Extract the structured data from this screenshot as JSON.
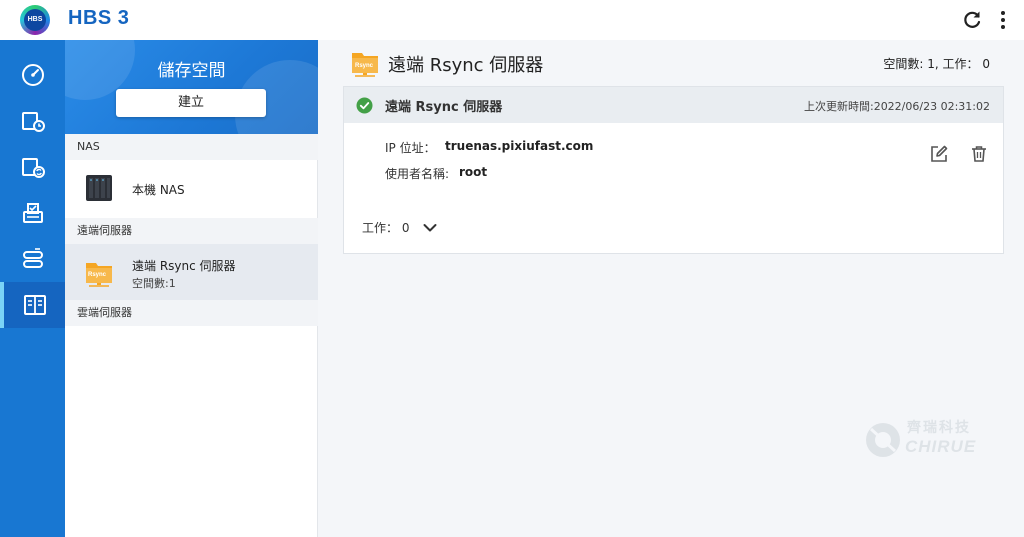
{
  "app": {
    "title": "HBS 3",
    "logo_text": "HBS"
  },
  "topbar": {
    "refresh_icon": "refresh-icon",
    "more_icon": "more-vertical-icon"
  },
  "rail": {
    "items": [
      {
        "icon": "speedometer-icon",
        "active": false
      },
      {
        "icon": "backup-icon",
        "active": false
      },
      {
        "icon": "sync-icon",
        "active": false
      },
      {
        "icon": "restore-icon",
        "active": false
      },
      {
        "icon": "services-icon",
        "active": false
      },
      {
        "icon": "storage-spaces-icon",
        "active": true
      }
    ]
  },
  "storage_panel": {
    "title": "儲存空間",
    "create_label": "建立",
    "sections": {
      "nas": "NAS",
      "remote": "遠端伺服器",
      "cloud": "雲端伺服器"
    },
    "local_nas": {
      "name": "本機 NAS"
    },
    "rsync": {
      "name": "遠端 Rsync 伺服器",
      "sub": "空間數:1",
      "badge": "Rsync"
    }
  },
  "main": {
    "title": "遠端 Rsync 伺服器",
    "counts": "空間數: 1, 工作： 0",
    "title_badge": "Rsync",
    "card": {
      "name": "遠端 Rsync 伺服器",
      "status": "ok",
      "updated": "上次更新時間:2022/06/23 02:31:02",
      "ip_label": "IP 位址：",
      "ip_value": "truenas.pixiufast.com",
      "user_label": "使用者名稱:",
      "user_value": "root",
      "jobs_label": "工作：",
      "jobs_value": "0"
    }
  },
  "watermark": {
    "cn": "齊瑞科技",
    "en": "CHIRUE"
  },
  "colors": {
    "brand": "#1565c0",
    "rail": "#1877d2",
    "success": "#43a047",
    "folder": "#f5a623"
  }
}
